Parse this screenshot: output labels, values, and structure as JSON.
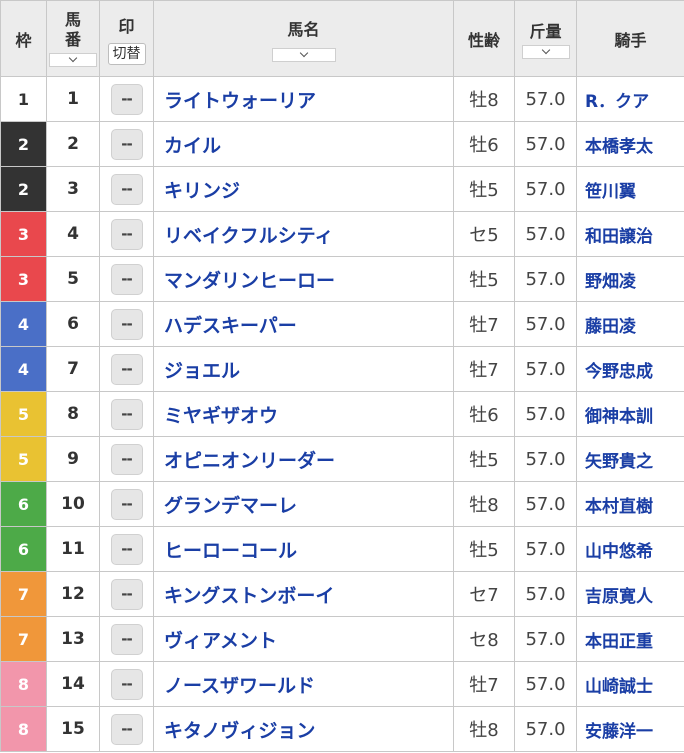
{
  "header": {
    "waku": "枠",
    "umaban_1": "馬",
    "umaban_2": "番",
    "mark": "印",
    "mark_toggle": "切替",
    "horse_name": "馬名",
    "sex_age": "性齢",
    "weight": "斤量",
    "jockey": "騎手"
  },
  "colors": {
    "waku_bg": {
      "1": "#ffffff",
      "2": "#333333",
      "3": "#e9484d",
      "4": "#4a6fc7",
      "5": "#e9c232",
      "6": "#4daa48",
      "7": "#f0973a",
      "8": "#f296ab"
    },
    "waku_fg": {
      "1": "#333333",
      "2": "#ffffff",
      "3": "#ffffff",
      "4": "#ffffff",
      "5": "#ffffff",
      "6": "#ffffff",
      "7": "#ffffff",
      "8": "#ffffff"
    },
    "link": "#1a3ea5"
  },
  "rows": [
    {
      "waku": "1",
      "umaban": "1",
      "mark": "--",
      "name": "ライトウォーリア",
      "sex_age": "牡8",
      "weight": "57.0",
      "jockey": "R．クア"
    },
    {
      "waku": "2",
      "umaban": "2",
      "mark": "--",
      "name": "カイル",
      "sex_age": "牡6",
      "weight": "57.0",
      "jockey": "本橋孝太"
    },
    {
      "waku": "2",
      "umaban": "3",
      "mark": "--",
      "name": "キリンジ",
      "sex_age": "牡5",
      "weight": "57.0",
      "jockey": "笹川翼"
    },
    {
      "waku": "3",
      "umaban": "4",
      "mark": "--",
      "name": "リベイクフルシティ",
      "sex_age": "セ5",
      "weight": "57.0",
      "jockey": "和田譲治"
    },
    {
      "waku": "3",
      "umaban": "5",
      "mark": "--",
      "name": "マンダリンヒーロー",
      "sex_age": "牡5",
      "weight": "57.0",
      "jockey": "野畑凌"
    },
    {
      "waku": "4",
      "umaban": "6",
      "mark": "--",
      "name": "ハデスキーパー",
      "sex_age": "牡7",
      "weight": "57.0",
      "jockey": "藤田凌"
    },
    {
      "waku": "4",
      "umaban": "7",
      "mark": "--",
      "name": "ジョエル",
      "sex_age": "牡7",
      "weight": "57.0",
      "jockey": "今野忠成"
    },
    {
      "waku": "5",
      "umaban": "8",
      "mark": "--",
      "name": "ミヤギザオウ",
      "sex_age": "牡6",
      "weight": "57.0",
      "jockey": "御神本訓"
    },
    {
      "waku": "5",
      "umaban": "9",
      "mark": "--",
      "name": "オピニオンリーダー",
      "sex_age": "牡5",
      "weight": "57.0",
      "jockey": "矢野貴之"
    },
    {
      "waku": "6",
      "umaban": "10",
      "mark": "--",
      "name": "グランデマーレ",
      "sex_age": "牡8",
      "weight": "57.0",
      "jockey": "本村直樹"
    },
    {
      "waku": "6",
      "umaban": "11",
      "mark": "--",
      "name": "ヒーローコール",
      "sex_age": "牡5",
      "weight": "57.0",
      "jockey": "山中悠希"
    },
    {
      "waku": "7",
      "umaban": "12",
      "mark": "--",
      "name": "キングストンボーイ",
      "sex_age": "セ7",
      "weight": "57.0",
      "jockey": "吉原寛人"
    },
    {
      "waku": "7",
      "umaban": "13",
      "mark": "--",
      "name": "ヴィアメント",
      "sex_age": "セ8",
      "weight": "57.0",
      "jockey": "本田正重"
    },
    {
      "waku": "8",
      "umaban": "14",
      "mark": "--",
      "name": "ノースザワールド",
      "sex_age": "牡7",
      "weight": "57.0",
      "jockey": "山崎誠士"
    },
    {
      "waku": "8",
      "umaban": "15",
      "mark": "--",
      "name": "キタノヴィジョン",
      "sex_age": "牡8",
      "weight": "57.0",
      "jockey": "安藤洋一"
    }
  ]
}
